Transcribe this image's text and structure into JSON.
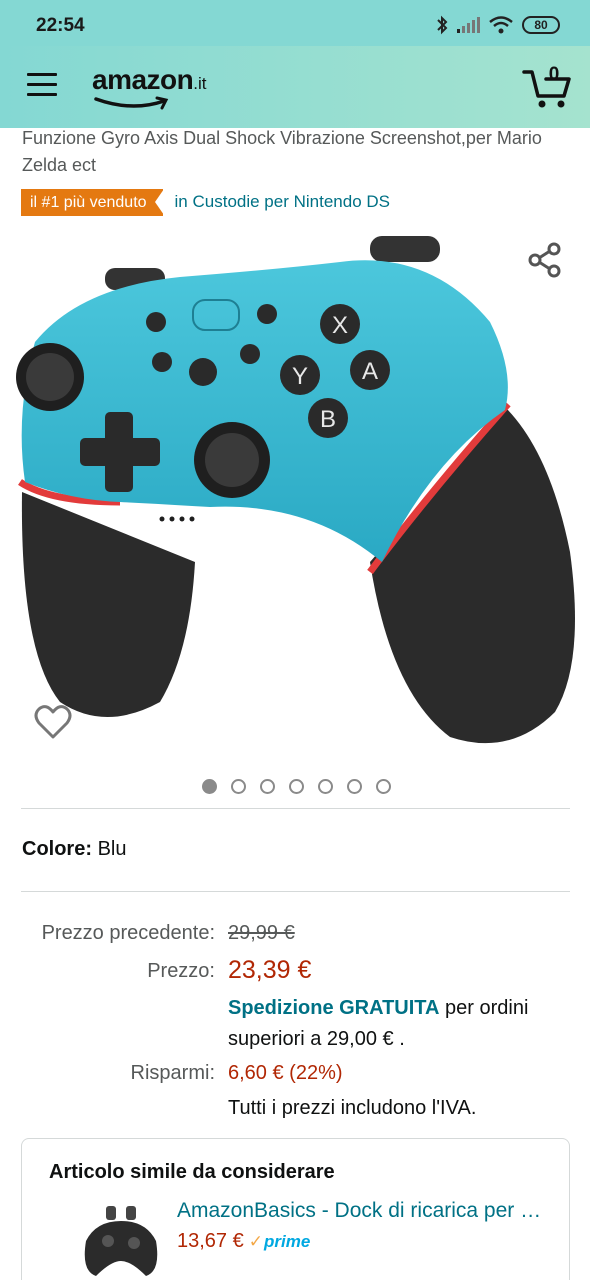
{
  "status_bar": {
    "time": "22:54",
    "battery": "80",
    "icons": [
      "bluetooth-icon",
      "signal-icon",
      "wifi-icon",
      "battery-icon"
    ]
  },
  "header": {
    "logo_text": "amazon",
    "logo_tld": ".it",
    "cart_count": "0",
    "background_color": "#84d8d3"
  },
  "product": {
    "title": "Funzione Gyro Axis Dual Shock Vibrazione Screenshot,per Mario Zelda ect",
    "bestseller_badge": "il #1 più venduto",
    "category_link": "in Custodie per Nintendo DS",
    "image_description_icon": "controller-image",
    "carousel_count": 7,
    "carousel_active_index": 0
  },
  "color": {
    "label": "Colore:",
    "value": "Blu"
  },
  "pricing": {
    "previous_label": "Prezzo precedente:",
    "previous_value": "29,99 €",
    "price_label": "Prezzo:",
    "price_value": "23,39 €",
    "shipping_strong": "Spedizione GRATUITA",
    "shipping_rest": " per ordini superiori a 29,00 € .",
    "savings_label": "Risparmi:",
    "savings_value": "6,60 € (22%)",
    "vat_note": "Tutti i prezzi includono l'IVA."
  },
  "similar": {
    "heading": "Articolo simile da considerare",
    "title": "AmazonBasics - Dock di ricarica per controller Nintendo Switch Pro",
    "price": "13,67 €",
    "prime_label": "prime"
  },
  "colors": {
    "link": "#007185",
    "price": "#b12704",
    "badge": "#e47911",
    "prime": "#00a8e1"
  }
}
